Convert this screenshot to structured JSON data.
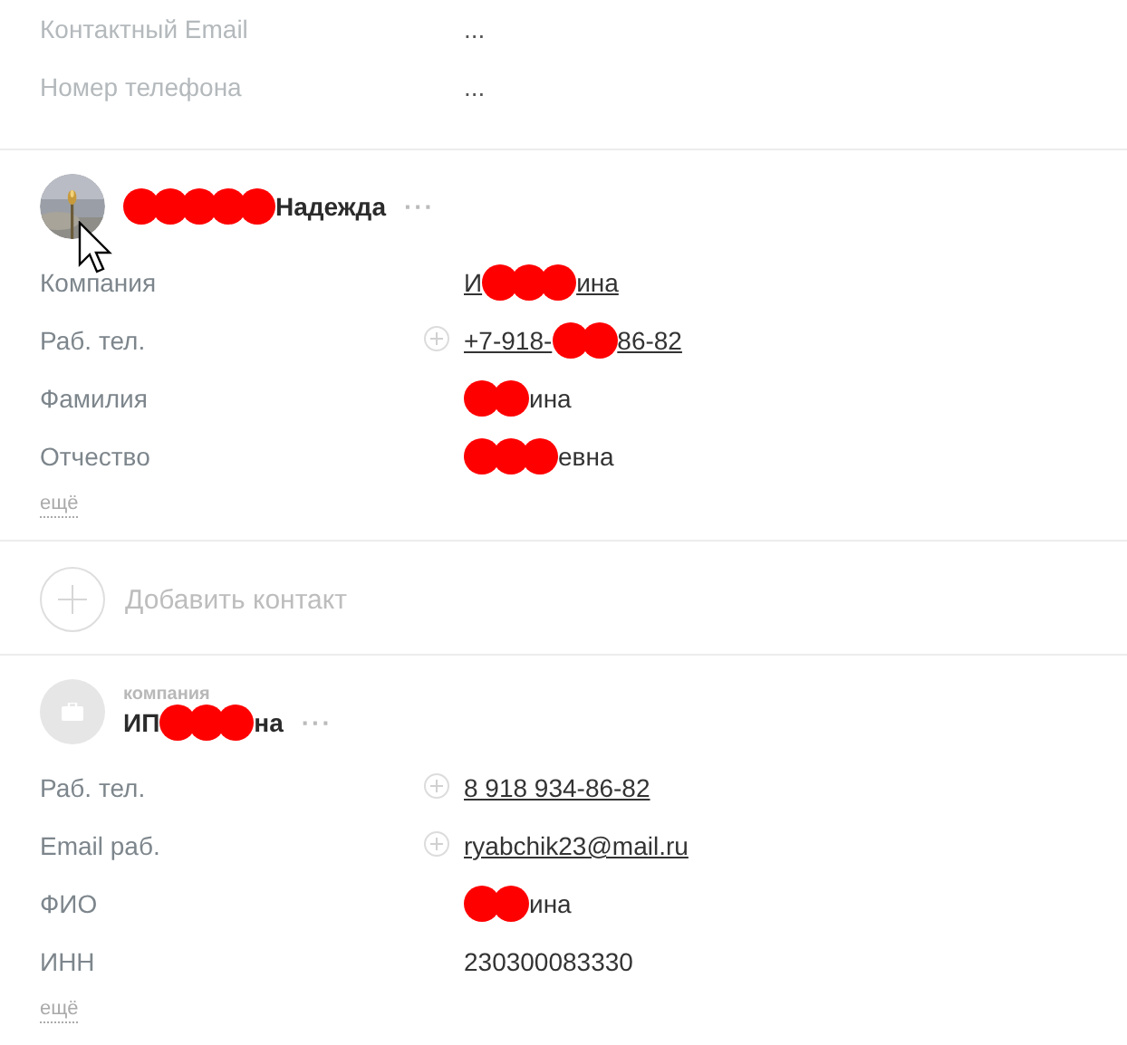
{
  "top_fields": [
    {
      "label": "Контактный Email",
      "value": "..."
    },
    {
      "label": "Номер телефона",
      "value": "..."
    }
  ],
  "contact": {
    "name": [
      {
        "kind": "redaction"
      },
      {
        "kind": "redaction"
      },
      {
        "kind": "redaction"
      },
      {
        "kind": "redaction"
      },
      {
        "kind": "redaction"
      },
      {
        "kind": "text",
        "text": "Надежда"
      }
    ],
    "menu": "···",
    "fields": [
      {
        "label": "Компания",
        "add_icon": false,
        "link": true,
        "value": [
          {
            "kind": "text",
            "text": "И"
          },
          {
            "kind": "redaction"
          },
          {
            "kind": "redaction"
          },
          {
            "kind": "redaction"
          },
          {
            "kind": "text",
            "text": "ина"
          }
        ]
      },
      {
        "label": "Раб. тел.",
        "add_icon": true,
        "link": true,
        "value": [
          {
            "kind": "text",
            "text": "+7-918-"
          },
          {
            "kind": "redaction"
          },
          {
            "kind": "redaction"
          },
          {
            "kind": "text",
            "text": "86-82"
          }
        ]
      },
      {
        "label": "Фамилия",
        "add_icon": false,
        "link": false,
        "value": [
          {
            "kind": "redaction"
          },
          {
            "kind": "redaction"
          },
          {
            "kind": "text",
            "text": "ина"
          }
        ]
      },
      {
        "label": "Отчество",
        "add_icon": false,
        "link": false,
        "value": [
          {
            "kind": "redaction"
          },
          {
            "kind": "redaction"
          },
          {
            "kind": "redaction"
          },
          {
            "kind": "text",
            "text": "евна"
          }
        ]
      }
    ],
    "more_link": "ещё"
  },
  "add_contact": {
    "label": "Добавить контакт"
  },
  "company": {
    "caption": "компания",
    "name": [
      {
        "kind": "text",
        "text": "ИП"
      },
      {
        "kind": "redaction"
      },
      {
        "kind": "redaction"
      },
      {
        "kind": "redaction"
      },
      {
        "kind": "text",
        "text": "на"
      }
    ],
    "menu": "···",
    "fields": [
      {
        "label": "Раб. тел.",
        "add_icon": true,
        "link": true,
        "value": [
          {
            "kind": "text",
            "text": "8 918 934-86-82"
          }
        ]
      },
      {
        "label": "Email раб.",
        "add_icon": true,
        "link": true,
        "value": [
          {
            "kind": "text",
            "text": "ryabchik23@mail.ru"
          }
        ]
      },
      {
        "label": "ФИО",
        "add_icon": false,
        "link": false,
        "value": [
          {
            "kind": "redaction"
          },
          {
            "kind": "redaction"
          },
          {
            "kind": "text",
            "text": "ина"
          }
        ]
      },
      {
        "label": "ИНН",
        "add_icon": false,
        "link": false,
        "value": [
          {
            "kind": "text",
            "text": "230300083330"
          }
        ]
      }
    ],
    "more_link": "ещё"
  }
}
